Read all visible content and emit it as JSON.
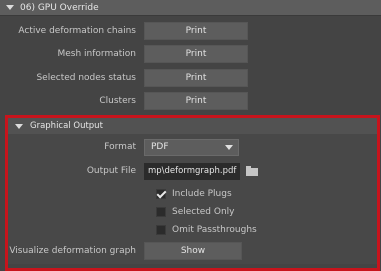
{
  "section": {
    "title": "06) GPU Override"
  },
  "gpu_rows": [
    {
      "label": "Active deformation chains",
      "button": "Print"
    },
    {
      "label": "Mesh information",
      "button": "Print"
    },
    {
      "label": "Selected nodes status",
      "button": "Print"
    },
    {
      "label": "Clusters",
      "button": "Print"
    }
  ],
  "graphical_output": {
    "title": "Graphical Output",
    "format_label": "Format",
    "format_value": "PDF",
    "output_file_label": "Output File",
    "output_file_value": "mp\\deformgraph.pdf",
    "checkboxes": [
      {
        "label": "Include Plugs",
        "checked": true
      },
      {
        "label": "Selected Only",
        "checked": false
      },
      {
        "label": "Omit Passthroughs",
        "checked": false
      }
    ],
    "visualize_label": "Visualize deformation graph",
    "visualize_button": "Show"
  },
  "highlight_color": "#c8141c"
}
